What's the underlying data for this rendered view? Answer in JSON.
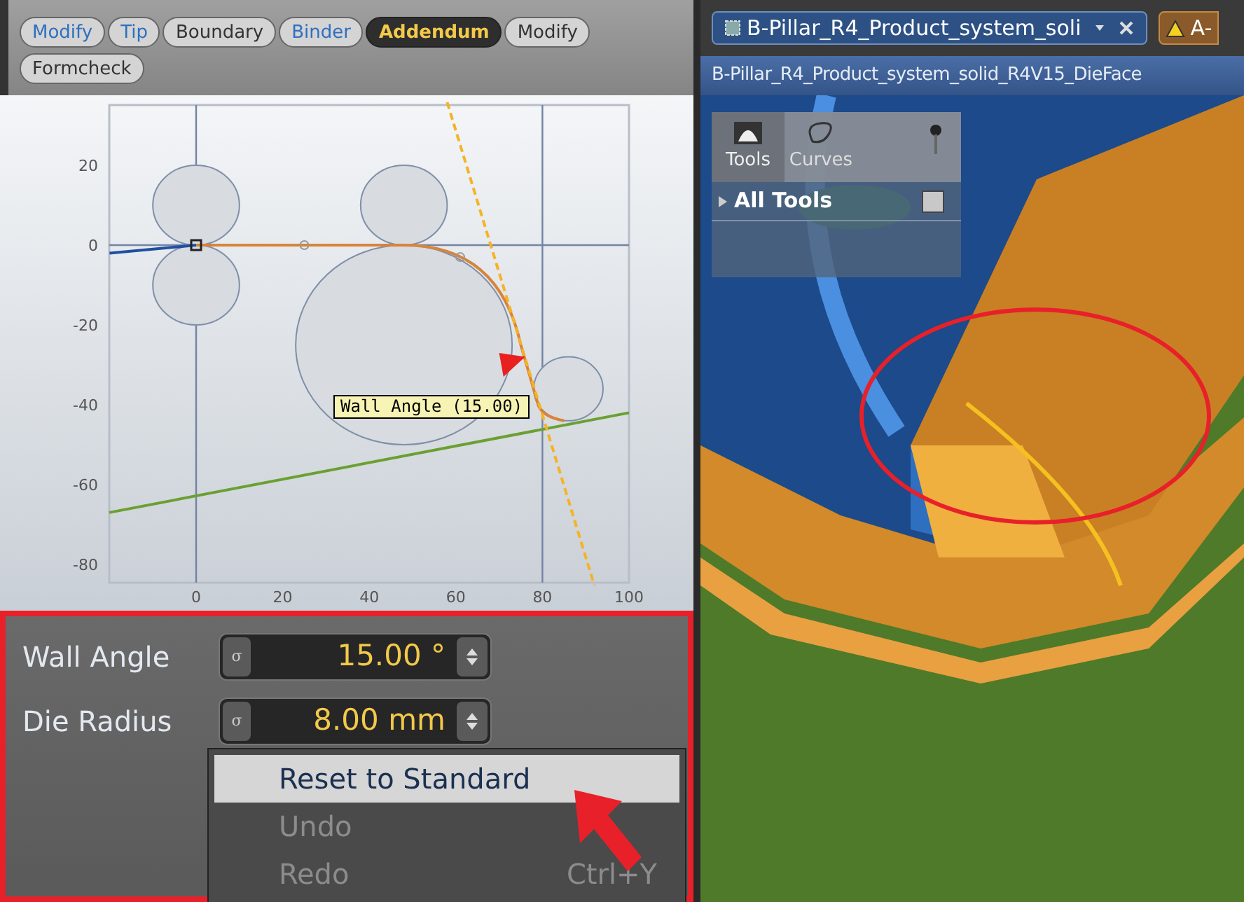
{
  "toolbar": {
    "buttons": [
      {
        "label": "Modify",
        "color": "#2f6fbf",
        "selected": false
      },
      {
        "label": "Tip",
        "color": "#2f6fbf",
        "selected": false
      },
      {
        "label": "Boundary",
        "color": "#333333",
        "selected": false
      },
      {
        "label": "Binder",
        "color": "#2f6fbf",
        "selected": false
      },
      {
        "label": "Addendum",
        "color": "#f3c94a",
        "selected": true
      },
      {
        "label": "Modify",
        "color": "#333333",
        "selected": false
      },
      {
        "label": "Formcheck",
        "color": "#333333",
        "selected": false
      }
    ]
  },
  "profile_plot": {
    "yticks": [
      "20",
      "0",
      "-20",
      "-40",
      "-60",
      "-80"
    ],
    "xticks": [
      "0",
      "20",
      "40",
      "60",
      "80",
      "100"
    ],
    "tooltip": "Wall Angle (15.00)"
  },
  "parameters": [
    {
      "label": "Wall Angle",
      "sigma": "σ",
      "value": "15.00 °"
    },
    {
      "label": "Die Radius",
      "sigma": "σ",
      "value": "8.00 mm"
    }
  ],
  "context_menu": [
    {
      "label": "Reset to Standard",
      "selected": true,
      "disabled": false
    },
    {
      "label": "Undo",
      "selected": false,
      "disabled": true
    },
    {
      "label": "Redo",
      "shortcut": "Ctrl+Y",
      "selected": false,
      "disabled": true
    }
  ],
  "viewport": {
    "tabs": [
      {
        "label": "B-Pillar_R4_Product_system_soli",
        "kind": "document",
        "selected": true
      },
      {
        "label": "A-",
        "kind": "warning",
        "selected": false
      }
    ],
    "title": "B-Pillar_R4_Product_system_solid_R4V15_DieFace",
    "tool_panel": {
      "tabs": [
        {
          "label": "Tools",
          "selected": true
        },
        {
          "label": "Curves",
          "selected": false
        }
      ],
      "tree": [
        {
          "label": "All Tools",
          "expanded": false,
          "checked": false
        }
      ]
    }
  }
}
